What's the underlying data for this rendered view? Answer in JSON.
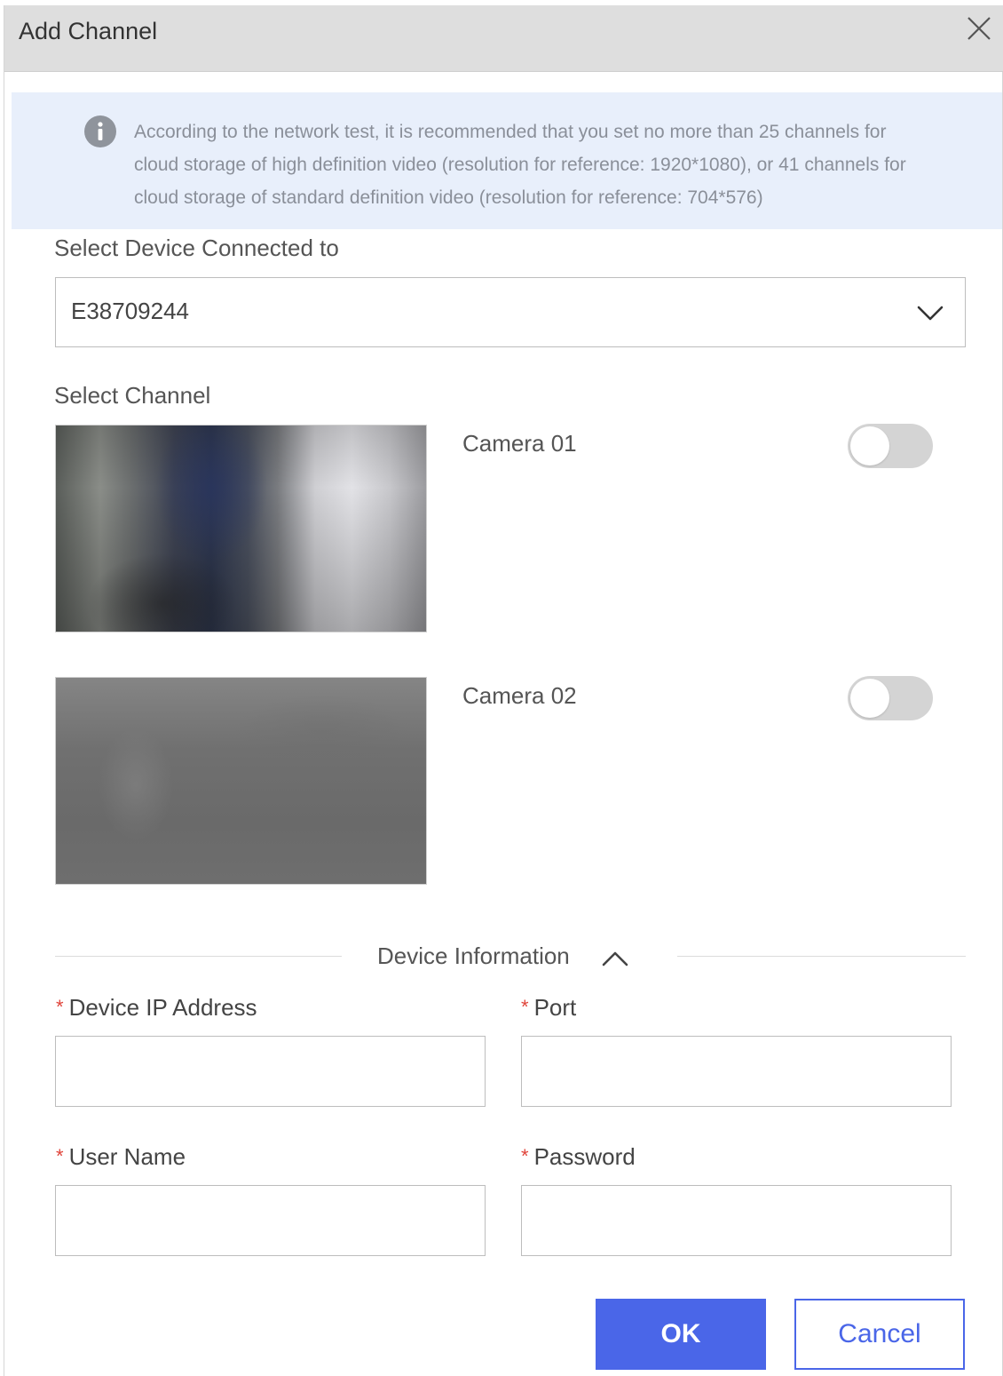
{
  "dialog": {
    "title": "Add Channel",
    "close_icon": "close-icon"
  },
  "notice": {
    "icon": "info-icon",
    "text": "According to the network test, it is recommended that you set no more than 25 channels for cloud storage of high definition video (resolution for reference: 1920*1080), or 41 channels for cloud storage of standard definition video (resolution for reference: 704*576)"
  },
  "device_select": {
    "label": "Select Device Connected to",
    "value": "E38709244",
    "icon": "chevron-down-icon"
  },
  "channels": {
    "label": "Select Channel",
    "items": [
      {
        "name": "Camera 01",
        "enabled": false
      },
      {
        "name": "Camera 02",
        "enabled": false
      }
    ]
  },
  "device_info": {
    "title": "Device Information",
    "icon": "chevron-up-icon",
    "required_mark": "*",
    "ip_label": "Device IP Address",
    "ip_value": "",
    "port_label": "Port",
    "port_value": "",
    "username_label": "User Name",
    "username_value": "",
    "password_label": "Password",
    "password_value": ""
  },
  "buttons": {
    "ok": "OK",
    "cancel": "Cancel"
  },
  "colors": {
    "primary": "#4a66e8",
    "notice_bg": "#e8effb",
    "required": "#e0443a",
    "toggle_off": "#d4d4d4"
  }
}
